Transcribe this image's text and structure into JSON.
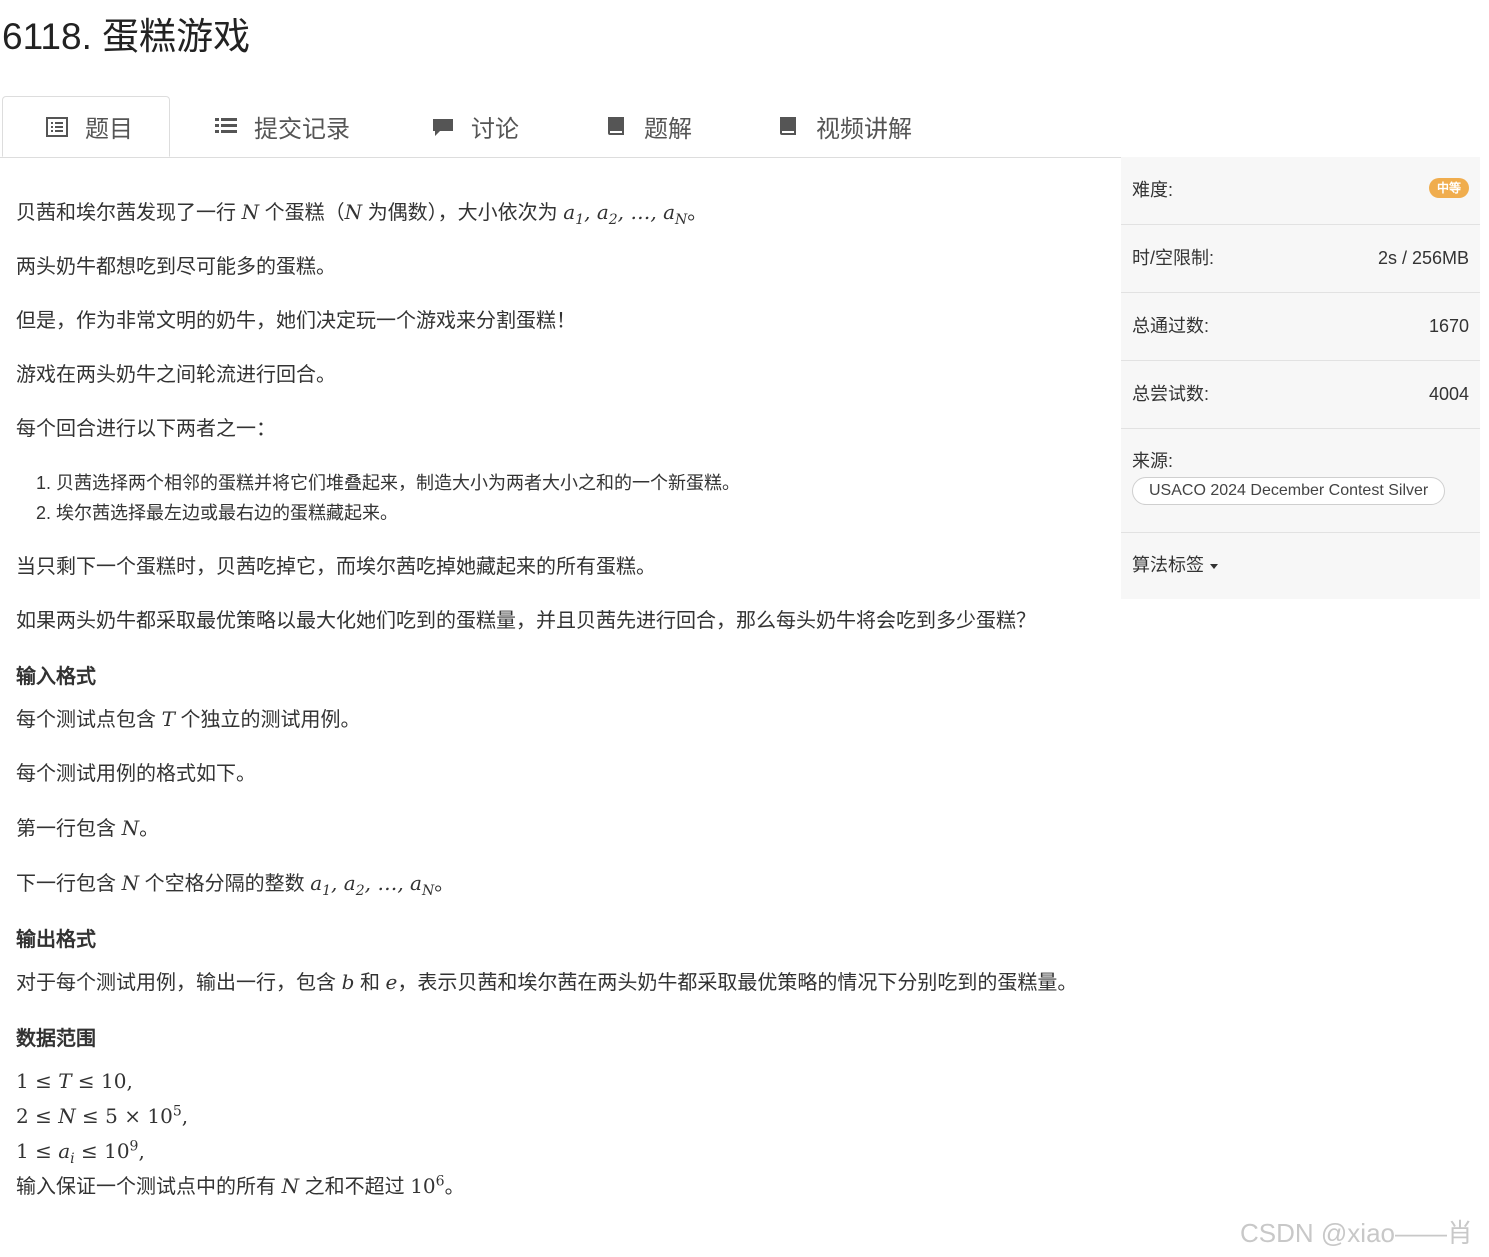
{
  "page": {
    "title": "6118. 蛋糕游戏"
  },
  "tabs": [
    {
      "label": "题目",
      "icon": "list-alt-icon",
      "active": true
    },
    {
      "label": "提交记录",
      "icon": "list-icon",
      "active": false
    },
    {
      "label": "讨论",
      "icon": "comment-icon",
      "active": false
    },
    {
      "label": "题解",
      "icon": "book-icon",
      "active": false
    },
    {
      "label": "视频讲解",
      "icon": "book-icon",
      "active": false
    }
  ],
  "problem": {
    "p1_a": "贝茜和埃尔茜发现了一行",
    "p1_b": "个蛋糕（",
    "p1_c": "为偶数），大小依次为",
    "p2": "两头奶牛都想吃到尽可能多的蛋糕。",
    "p3": "但是，作为非常文明的奶牛，她们决定玩一个游戏来分割蛋糕！",
    "p4": "游戏在两头奶牛之间轮流进行回合。",
    "p5": "每个回合进行以下两者之一：",
    "list": [
      "贝茜选择两个相邻的蛋糕并将它们堆叠起来，制造大小为两者大小之和的一个新蛋糕。",
      "埃尔茜选择最左边或最右边的蛋糕藏起来。"
    ],
    "p6": "当只剩下一个蛋糕时，贝茜吃掉它，而埃尔茜吃掉她藏起来的所有蛋糕。",
    "p7": "如果两头奶牛都采取最优策略以最大化她们吃到的蛋糕量，并且贝茜先进行回合，那么每头奶牛将会吃到多少蛋糕？",
    "input_heading": "输入格式",
    "in1_a": "每个测试点包含",
    "in1_b": "个独立的测试用例。",
    "in2": "每个测试用例的格式如下。",
    "in3_a": "第一行包含",
    "in4_a": "下一行包含",
    "in4_b": "个空格分隔的整数",
    "output_heading": "输出格式",
    "out1_a": "对于每个测试用例，输出一行，包含",
    "out1_b": "和",
    "out1_c": "，表示贝茜和埃尔茜在两头奶牛都采取最优策略的情况下分别吃到的蛋糕量。",
    "range_heading": "数据范围",
    "r4_a": "输入保证一个测试点中的所有",
    "r4_b": "之和不超过"
  },
  "sidebar": {
    "difficulty_label": "难度:",
    "difficulty_value": "中等",
    "limit_label": "时/空限制:",
    "limit_value": "2s / 256MB",
    "passed_label": "总通过数:",
    "passed_value": "1670",
    "attempts_label": "总尝试数:",
    "attempts_value": "4004",
    "source_label": "来源:",
    "source_value": "USACO 2024 December Contest Silver",
    "tags_label": "算法标签"
  },
  "watermark": "CSDN @xiao——肖"
}
